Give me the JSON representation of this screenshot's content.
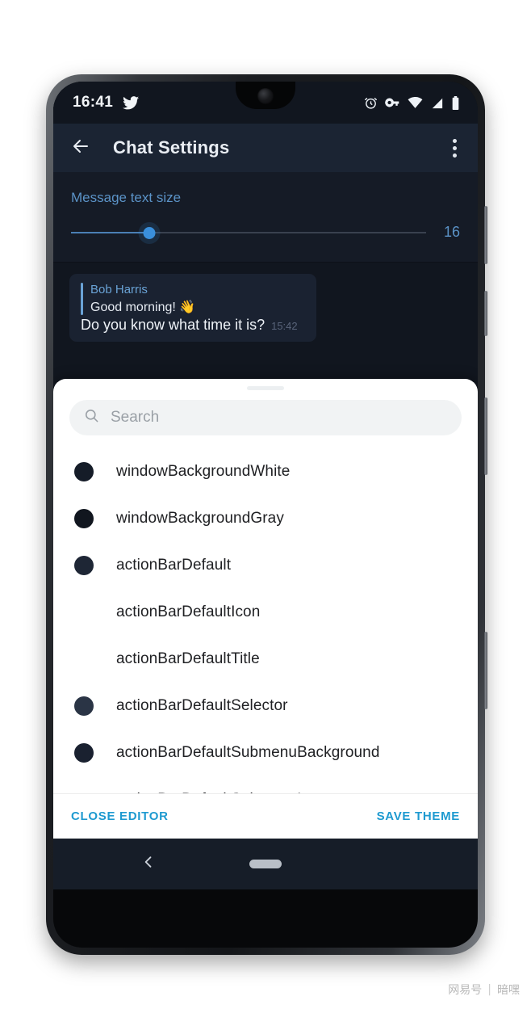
{
  "status_bar": {
    "time": "16:41",
    "left_icons": [
      "twitter-icon"
    ],
    "right_icons": [
      "alarm-icon",
      "vpn-key-icon",
      "wifi-icon",
      "cell-signal-icon",
      "battery-icon"
    ]
  },
  "app_bar": {
    "back_label": "back-arrow",
    "title": "Chat Settings",
    "overflow_label": "more-options"
  },
  "text_size_section": {
    "label": "Message text size",
    "value": "16",
    "slider": {
      "min": 12,
      "max": 30,
      "value": 16,
      "percent": 22
    }
  },
  "chat_preview": {
    "reply": {
      "author": "Bob Harris",
      "text": "Good morning! 👋"
    },
    "message": "Do you know what time it is?",
    "timestamp": "15:42"
  },
  "sheet": {
    "search": {
      "placeholder": "Search",
      "value": "",
      "icon": "search-icon"
    },
    "items": [
      {
        "name": "windowBackgroundWhite",
        "swatch": "#151c28",
        "has_swatch": true
      },
      {
        "name": "windowBackgroundGray",
        "swatch": "#11161f",
        "has_swatch": true
      },
      {
        "name": "actionBarDefault",
        "swatch": "#1e2635",
        "has_swatch": true
      },
      {
        "name": "actionBarDefaultIcon",
        "swatch": "",
        "has_swatch": false
      },
      {
        "name": "actionBarDefaultTitle",
        "swatch": "",
        "has_swatch": false
      },
      {
        "name": "actionBarDefaultSelector",
        "swatch": "#2a3445",
        "has_swatch": true
      },
      {
        "name": "actionBarDefaultSubmenuBackground",
        "swatch": "#1a2130",
        "has_swatch": true
      },
      {
        "name": "actionBarDefaultSubmenuItem",
        "swatch": "",
        "has_swatch": false
      }
    ],
    "actions": {
      "close_label": "CLOSE EDITOR",
      "save_label": "SAVE THEME"
    }
  },
  "nav_bar": {
    "back": "nav-back-icon",
    "home_pill": "nav-home-pill"
  },
  "watermark": {
    "brand": "网易号",
    "separator": "|",
    "account": "暗嘿"
  },
  "colors": {
    "accent": "#1e9ad0",
    "app_bar_bg": "#1b2433",
    "screen_bg": "#11161f",
    "slider_active": "#3a8fdb",
    "section_label": "#5b93c7",
    "sheet_bg": "#ffffff"
  }
}
